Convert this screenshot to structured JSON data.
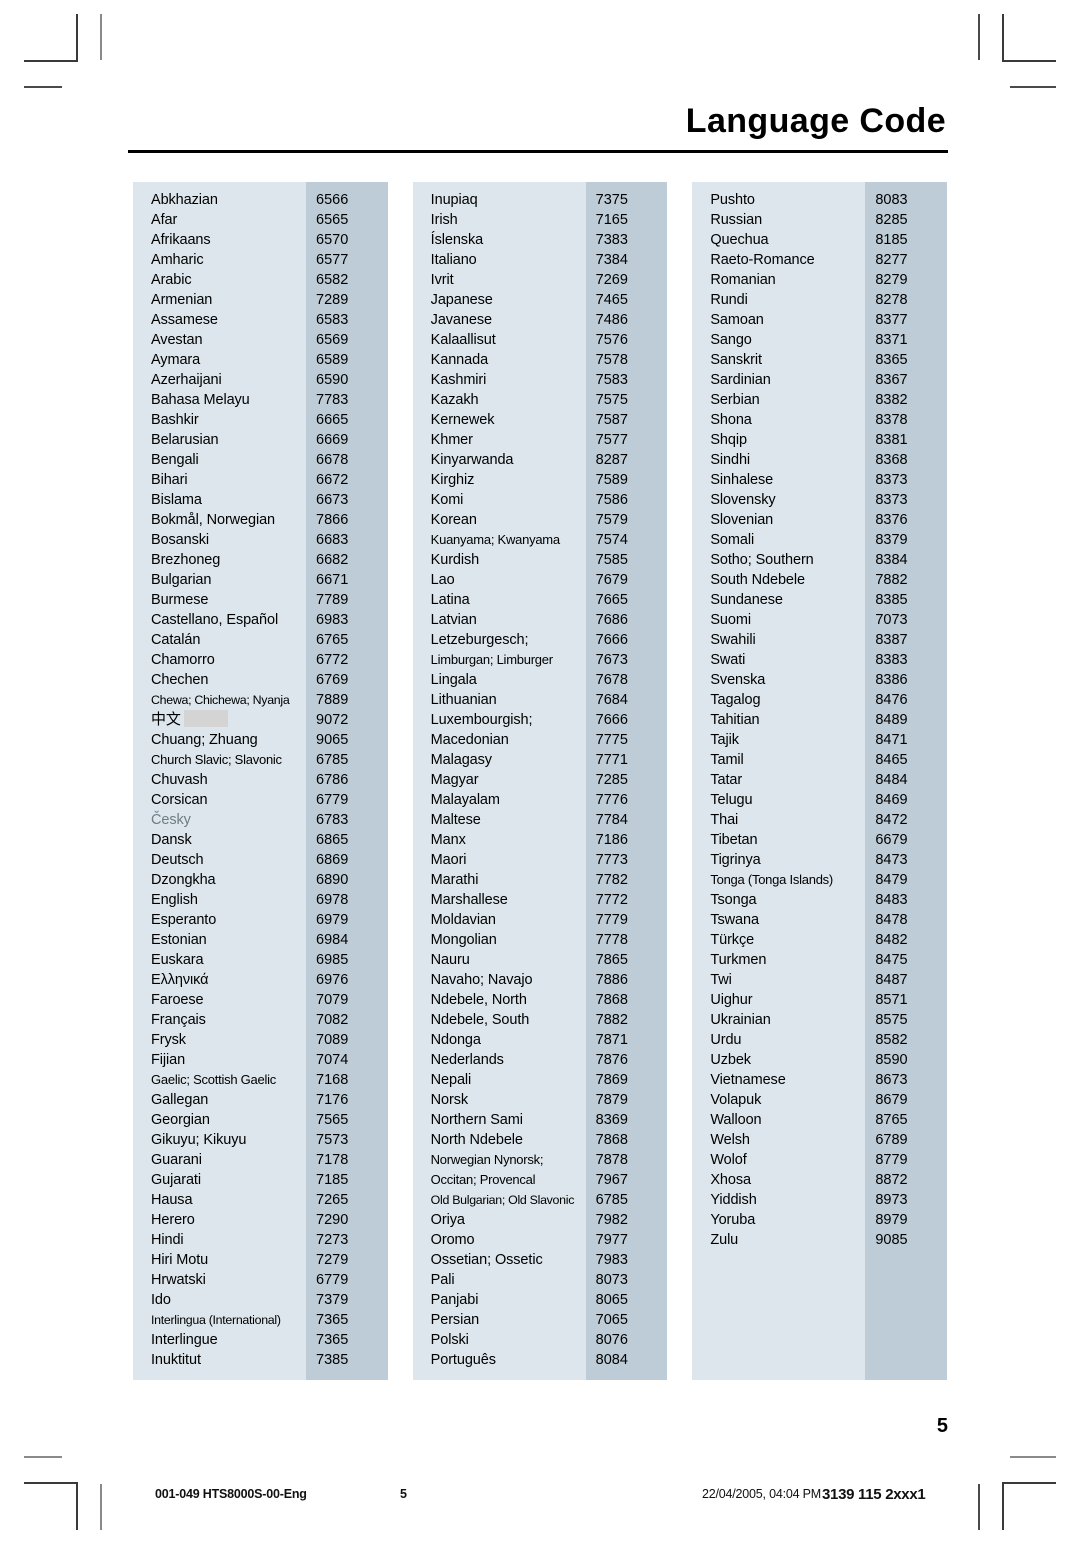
{
  "header": {
    "title": "Language Code"
  },
  "page_number_large": "5",
  "footer": {
    "document_id": "001-049 HTS8000S-00-Eng",
    "page": "5",
    "timestamp": "22/04/2005, 04:04 PM",
    "part_number": "3139 115 2xxx1"
  },
  "icons": {
    "crop_mark_top_left": "crop-mark-icon",
    "crop_mark_top_right": "crop-mark-icon",
    "crop_mark_bottom_left": "crop-mark-icon",
    "crop_mark_bottom_right": "crop-mark-icon"
  },
  "colors": {
    "name_cell_bg": "#dce6ec",
    "code_cell_bg": "#bdccd6",
    "redaction_box": "#d4d4d4",
    "rule": "#000000"
  },
  "columns": [
    {
      "id": "column-1",
      "rows": [
        {
          "name": "Abkhazian",
          "code": "6566"
        },
        {
          "name": "Afar",
          "code": "6565"
        },
        {
          "name": "Afrikaans",
          "code": "6570"
        },
        {
          "name": "Amharic",
          "code": "6577"
        },
        {
          "name": "Arabic",
          "code": "6582"
        },
        {
          "name": "Armenian",
          "code": "7289"
        },
        {
          "name": "Assamese",
          "code": "6583"
        },
        {
          "name": "Avestan",
          "code": "6569"
        },
        {
          "name": "Aymara",
          "code": "6589"
        },
        {
          "name": "Azerhaijani",
          "code": "6590"
        },
        {
          "name": "Bahasa Melayu",
          "code": "7783"
        },
        {
          "name": "Bashkir",
          "code": "6665"
        },
        {
          "name": "Belarusian",
          "code": "6669"
        },
        {
          "name": "Bengali",
          "code": "6678"
        },
        {
          "name": "Bihari",
          "code": "6672"
        },
        {
          "name": "Bislama",
          "code": "6673"
        },
        {
          "name": "Bokmål, Norwegian",
          "code": "7866"
        },
        {
          "name": "Bosanski",
          "code": "6683"
        },
        {
          "name": "Brezhoneg",
          "code": "6682"
        },
        {
          "name": "Bulgarian",
          "code": "6671"
        },
        {
          "name": "Burmese",
          "code": "7789"
        },
        {
          "name": "Castellano, Español",
          "code": "6983"
        },
        {
          "name": "Catalán",
          "code": "6765"
        },
        {
          "name": "Chamorro",
          "code": "6772"
        },
        {
          "name": "Chechen",
          "code": "6769"
        },
        {
          "name": "Chewa; Chichewa; Nyanja",
          "code": "7889",
          "style": "tight"
        },
        {
          "name": "中文",
          "code": "9072",
          "style": "cjk-redacted"
        },
        {
          "name": "Chuang; Zhuang",
          "code": "9065"
        },
        {
          "name": "Church Slavic; Slavonic",
          "code": "6785",
          "style": "tight2"
        },
        {
          "name": "Chuvash",
          "code": "6786"
        },
        {
          "name": "Corsican",
          "code": "6779"
        },
        {
          "name": "Česky",
          "code": "6783",
          "style": "muted"
        },
        {
          "name": "Dansk",
          "code": "6865"
        },
        {
          "name": "Deutsch",
          "code": "6869"
        },
        {
          "name": "Dzongkha",
          "code": "6890"
        },
        {
          "name": "English",
          "code": "6978"
        },
        {
          "name": "Esperanto",
          "code": "6979"
        },
        {
          "name": "Estonian",
          "code": "6984"
        },
        {
          "name": "Euskara",
          "code": "6985"
        },
        {
          "name": "Ελληνικά",
          "code": "6976"
        },
        {
          "name": "Faroese",
          "code": "7079"
        },
        {
          "name": "Français",
          "code": "7082"
        },
        {
          "name": "Frysk",
          "code": "7089"
        },
        {
          "name": "Fijian",
          "code": "7074"
        },
        {
          "name": "Gaelic; Scottish Gaelic",
          "code": "7168",
          "style": "tight2"
        },
        {
          "name": "Gallegan",
          "code": "7176"
        },
        {
          "name": "Georgian",
          "code": "7565"
        },
        {
          "name": "Gikuyu; Kikuyu",
          "code": "7573"
        },
        {
          "name": "Guarani",
          "code": "7178"
        },
        {
          "name": "Gujarati",
          "code": "7185"
        },
        {
          "name": "Hausa",
          "code": "7265"
        },
        {
          "name": "Herero",
          "code": "7290"
        },
        {
          "name": "Hindi",
          "code": "7273"
        },
        {
          "name": "Hiri Motu",
          "code": "7279"
        },
        {
          "name": "Hrwatski",
          "code": "6779"
        },
        {
          "name": "Ido",
          "code": "7379"
        },
        {
          "name": "Interlingua (International)",
          "code": "7365",
          "style": "tight"
        },
        {
          "name": "Interlingue",
          "code": "7365"
        },
        {
          "name": "Inuktitut",
          "code": "7385"
        }
      ]
    },
    {
      "id": "column-2",
      "rows": [
        {
          "name": "Inupiaq",
          "code": "7375"
        },
        {
          "name": "Irish",
          "code": "7165"
        },
        {
          "name": "Íslenska",
          "code": "7383"
        },
        {
          "name": "Italiano",
          "code": "7384"
        },
        {
          "name": "Ivrit",
          "code": "7269"
        },
        {
          "name": "Japanese",
          "code": "7465"
        },
        {
          "name": "Javanese",
          "code": "7486"
        },
        {
          "name": "Kalaallisut",
          "code": "7576"
        },
        {
          "name": "Kannada",
          "code": "7578"
        },
        {
          "name": "Kashmiri",
          "code": "7583"
        },
        {
          "name": "Kazakh",
          "code": "7575"
        },
        {
          "name": "Kernewek",
          "code": "7587"
        },
        {
          "name": "Khmer",
          "code": "7577"
        },
        {
          "name": "Kinyarwanda",
          "code": "8287"
        },
        {
          "name": "Kirghiz",
          "code": "7589"
        },
        {
          "name": "Komi",
          "code": "7586"
        },
        {
          "name": "Korean",
          "code": "7579"
        },
        {
          "name": "Kuanyama; Kwanyama",
          "code": "7574",
          "style": "tight2"
        },
        {
          "name": "Kurdish",
          "code": "7585"
        },
        {
          "name": "Lao",
          "code": "7679"
        },
        {
          "name": "Latina",
          "code": "7665"
        },
        {
          "name": "Latvian",
          "code": "7686"
        },
        {
          "name": "Letzeburgesch;",
          "code": "7666"
        },
        {
          "name": "Limburgan; Limburger",
          "code": "7673",
          "style": "tight2"
        },
        {
          "name": "Lingala",
          "code": "7678"
        },
        {
          "name": "Lithuanian",
          "code": "7684"
        },
        {
          "name": "Luxembourgish;",
          "code": "7666"
        },
        {
          "name": "Macedonian",
          "code": "7775"
        },
        {
          "name": "Malagasy",
          "code": "7771"
        },
        {
          "name": "Magyar",
          "code": "7285"
        },
        {
          "name": "Malayalam",
          "code": "7776"
        },
        {
          "name": "Maltese",
          "code": "7784"
        },
        {
          "name": "Manx",
          "code": "7186"
        },
        {
          "name": "Maori",
          "code": "7773"
        },
        {
          "name": "Marathi",
          "code": "7782"
        },
        {
          "name": "Marshallese",
          "code": "7772"
        },
        {
          "name": "Moldavian",
          "code": "7779"
        },
        {
          "name": "Mongolian",
          "code": "7778"
        },
        {
          "name": "Nauru",
          "code": "7865"
        },
        {
          "name": "Navaho; Navajo",
          "code": "7886"
        },
        {
          "name": "Ndebele, North",
          "code": "7868"
        },
        {
          "name": "Ndebele, South",
          "code": "7882"
        },
        {
          "name": "Ndonga",
          "code": "7871"
        },
        {
          "name": "Nederlands",
          "code": "7876"
        },
        {
          "name": "Nepali",
          "code": "7869"
        },
        {
          "name": "Norsk",
          "code": "7879"
        },
        {
          "name": "Northern Sami",
          "code": "8369"
        },
        {
          "name": "North Ndebele",
          "code": "7868"
        },
        {
          "name": "Norwegian Nynorsk;",
          "code": "7878",
          "style": "tight2"
        },
        {
          "name": "Occitan; Provencal",
          "code": "7967",
          "style": "tight2"
        },
        {
          "name": "Old Bulgarian; Old Slavonic",
          "code": "6785",
          "style": "tight"
        },
        {
          "name": "Oriya",
          "code": "7982"
        },
        {
          "name": "Oromo",
          "code": "7977"
        },
        {
          "name": "Ossetian; Ossetic",
          "code": "7983"
        },
        {
          "name": "Pali",
          "code": "8073"
        },
        {
          "name": "Panjabi",
          "code": "8065"
        },
        {
          "name": "Persian",
          "code": "7065"
        },
        {
          "name": "Polski",
          "code": "8076"
        },
        {
          "name": "Português",
          "code": "8084"
        }
      ]
    },
    {
      "id": "column-3",
      "rows": [
        {
          "name": "Pushto",
          "code": "8083"
        },
        {
          "name": "Russian",
          "code": "8285"
        },
        {
          "name": "Quechua",
          "code": "8185"
        },
        {
          "name": "Raeto-Romance",
          "code": "8277"
        },
        {
          "name": "Romanian",
          "code": "8279"
        },
        {
          "name": "Rundi",
          "code": "8278"
        },
        {
          "name": "Samoan",
          "code": "8377"
        },
        {
          "name": "Sango",
          "code": "8371"
        },
        {
          "name": "Sanskrit",
          "code": "8365"
        },
        {
          "name": "Sardinian",
          "code": "8367"
        },
        {
          "name": "Serbian",
          "code": "8382"
        },
        {
          "name": "Shona",
          "code": "8378"
        },
        {
          "name": "Shqip",
          "code": "8381"
        },
        {
          "name": "Sindhi",
          "code": "8368"
        },
        {
          "name": "Sinhalese",
          "code": "8373"
        },
        {
          "name": "Slovensky",
          "code": "8373"
        },
        {
          "name": "Slovenian",
          "code": "8376"
        },
        {
          "name": "Somali",
          "code": "8379"
        },
        {
          "name": "Sotho; Southern",
          "code": "8384"
        },
        {
          "name": "South Ndebele",
          "code": "7882"
        },
        {
          "name": "Sundanese",
          "code": "8385"
        },
        {
          "name": "Suomi",
          "code": "7073"
        },
        {
          "name": "Swahili",
          "code": "8387"
        },
        {
          "name": "Swati",
          "code": "8383"
        },
        {
          "name": "Svenska",
          "code": "8386"
        },
        {
          "name": "Tagalog",
          "code": "8476"
        },
        {
          "name": "Tahitian",
          "code": "8489"
        },
        {
          "name": "Tajik",
          "code": "8471"
        },
        {
          "name": "Tamil",
          "code": "8465"
        },
        {
          "name": "Tatar",
          "code": "8484"
        },
        {
          "name": "Telugu",
          "code": "8469"
        },
        {
          "name": "Thai",
          "code": "8472"
        },
        {
          "name": "Tibetan",
          "code": "6679"
        },
        {
          "name": "Tigrinya",
          "code": "8473"
        },
        {
          "name": "Tonga (Tonga Islands)",
          "code": "8479",
          "style": "tight2"
        },
        {
          "name": "Tsonga",
          "code": "8483"
        },
        {
          "name": "Tswana",
          "code": "8478"
        },
        {
          "name": "Türkçe",
          "code": "8482"
        },
        {
          "name": "Turkmen",
          "code": "8475"
        },
        {
          "name": "Twi",
          "code": "8487"
        },
        {
          "name": "Uighur",
          "code": "8571"
        },
        {
          "name": "Ukrainian",
          "code": "8575"
        },
        {
          "name": "Urdu",
          "code": "8582"
        },
        {
          "name": "Uzbek",
          "code": "8590"
        },
        {
          "name": "Vietnamese",
          "code": "8673"
        },
        {
          "name": "Volapuk",
          "code": "8679"
        },
        {
          "name": "Walloon",
          "code": "8765"
        },
        {
          "name": "Welsh",
          "code": "6789"
        },
        {
          "name": "Wolof",
          "code": "8779"
        },
        {
          "name": "Xhosa",
          "code": "8872"
        },
        {
          "name": "Yiddish",
          "code": "8973"
        },
        {
          "name": "Yoruba",
          "code": "8979"
        },
        {
          "name": "Zulu",
          "code": "9085"
        },
        {
          "name": "",
          "code": ""
        },
        {
          "name": "",
          "code": ""
        },
        {
          "name": "",
          "code": ""
        },
        {
          "name": "",
          "code": ""
        },
        {
          "name": "",
          "code": ""
        },
        {
          "name": "",
          "code": ""
        }
      ]
    }
  ]
}
